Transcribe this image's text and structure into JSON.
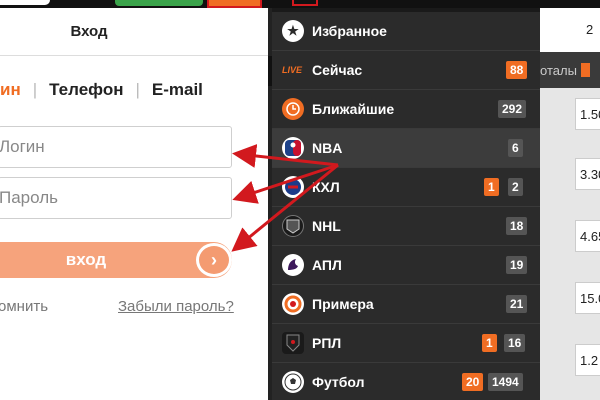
{
  "login": {
    "title": "Вход",
    "tabs": [
      "ин",
      "Телефон",
      "E-mail"
    ],
    "login_placeholder": "Логин",
    "password_placeholder": "Пароль",
    "submit_label": "Вход",
    "remember_label": "омнить",
    "forgot_label": "Забыли пароль?"
  },
  "menu": {
    "items": [
      {
        "label": "Избранное",
        "icon": "star-icon",
        "badges": []
      },
      {
        "label": "Сейчас",
        "icon": "live-icon",
        "icon_text": "LIVE",
        "badges": [
          {
            "value": "88",
            "color": "orange"
          }
        ]
      },
      {
        "label": "Ближайшие",
        "icon": "clock-icon",
        "badges": [
          {
            "value": "292",
            "color": "gray"
          }
        ]
      },
      {
        "label": "NBA",
        "icon": "nba-logo-icon",
        "badges": [
          {
            "value": "6",
            "color": "gray"
          }
        ]
      },
      {
        "label": "КХЛ",
        "icon": "khl-logo-icon",
        "badges": [
          {
            "value": "1",
            "color": "orange"
          },
          {
            "value": "2",
            "color": "gray"
          }
        ]
      },
      {
        "label": "NHL",
        "icon": "nhl-logo-icon",
        "badges": [
          {
            "value": "18",
            "color": "gray"
          }
        ]
      },
      {
        "label": "АПЛ",
        "icon": "epl-logo-icon",
        "badges": [
          {
            "value": "19",
            "color": "gray"
          }
        ]
      },
      {
        "label": "Примера",
        "icon": "laliga-logo-icon",
        "badges": [
          {
            "value": "21",
            "color": "gray"
          }
        ]
      },
      {
        "label": "РПЛ",
        "icon": "rpl-logo-icon",
        "badges": [
          {
            "value": "1",
            "color": "orange"
          },
          {
            "value": "16",
            "color": "gray"
          }
        ]
      },
      {
        "label": "Футбол",
        "icon": "football-icon",
        "badges": [
          {
            "value": "20",
            "color": "orange"
          },
          {
            "value": "1494",
            "color": "gray"
          }
        ]
      }
    ]
  },
  "right": {
    "header_value": "2",
    "strip_text": "оталы",
    "odds": [
      "1.50",
      "3.30",
      "4.65",
      "15.0",
      "1.2"
    ]
  },
  "colors": {
    "accent": "#f06d23",
    "menu_bg": "#2b2b2b",
    "arrow": "#d2191e",
    "button": "#f6a37c"
  }
}
